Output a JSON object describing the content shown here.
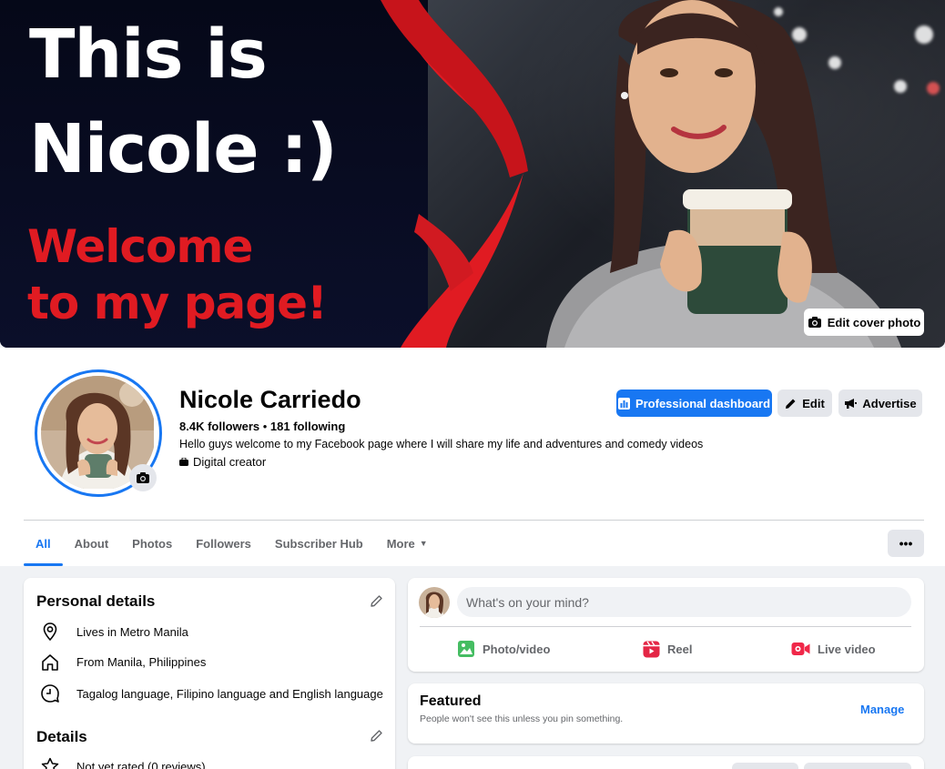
{
  "cover": {
    "line1": "This is",
    "line2": "Nicole :)",
    "line3": "Welcome",
    "line4": "to my page!",
    "edit_button": "Edit cover photo"
  },
  "profile": {
    "name": "Nicole Carriedo",
    "followers": "8.4K followers",
    "separator": " • ",
    "following": "181 following",
    "bio": "Hello guys welcome to my Facebook page where I will share my life and adventures and comedy videos",
    "category": "Digital creator"
  },
  "actions": {
    "professional_dashboard": "Professional dashboard",
    "edit": "Edit",
    "advertise": "Advertise"
  },
  "tabs": [
    {
      "label": "All",
      "active": true
    },
    {
      "label": "About"
    },
    {
      "label": "Photos"
    },
    {
      "label": "Followers"
    },
    {
      "label": "Subscriber Hub"
    },
    {
      "label": "More"
    }
  ],
  "more_menu": "•••",
  "personal_details": {
    "title": "Personal details",
    "items": [
      {
        "icon": "location-pin-icon",
        "text": "Lives in Metro Manila"
      },
      {
        "icon": "home-icon",
        "text": "From Manila, Philippines"
      },
      {
        "icon": "language-icon",
        "l1": "Tagalog language",
        "sep1": ", ",
        "l2": "Filipino language",
        "sep2": " and ",
        "l3": "English language"
      }
    ]
  },
  "details": {
    "title": "Details",
    "items": [
      {
        "icon": "star-icon",
        "text": "Not yet rated (0 reviews)"
      }
    ]
  },
  "composer": {
    "placeholder": "What's on your mind?",
    "photo_video": "Photo/video",
    "reel": "Reel",
    "live_video": "Live video"
  },
  "featured": {
    "title": "Featured",
    "subtitle": "People won't see this unless you pin something.",
    "manage": "Manage"
  },
  "colors": {
    "accent": "#1877f2",
    "cover_red": "#e01b22",
    "photo_green": "#45bd62",
    "reel_pink": "#e42645",
    "live_red": "#f02849"
  }
}
